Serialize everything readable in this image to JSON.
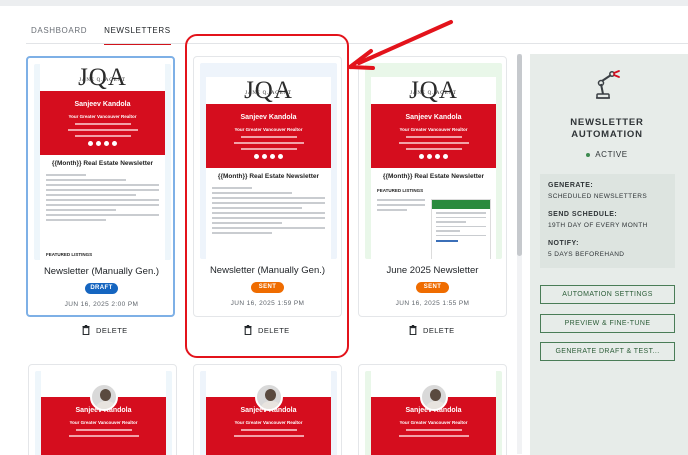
{
  "tabs": [
    {
      "label": "DASHBOARD"
    },
    {
      "label": "NEWSLETTERS"
    }
  ],
  "logo": {
    "mark": "JQA",
    "sub": "JANE Q. AGENT"
  },
  "template": {
    "agent_name": "Sanjeev Kandola",
    "tagline": "Your Greater Vancouver Realtor",
    "newsletter_title": "{{Month}} Real Estate Newsletter",
    "featured_label": "FEATURED LISTINGS"
  },
  "cards": [
    {
      "title": "Newsletter (Manually Gen.)",
      "status": "DRAFT",
      "date": "JUN 16, 2025 2:00 PM",
      "delete_label": "DELETE"
    },
    {
      "title": "Newsletter (Manually Gen.)",
      "status": "SENT",
      "date": "JUN 16, 2025 1:59 PM",
      "delete_label": "DELETE"
    },
    {
      "title": "June 2025 Newsletter",
      "status": "SENT",
      "date": "JUN 16, 2025 1:55 PM",
      "delete_label": "DELETE"
    }
  ],
  "automation": {
    "title_line1": "NEWSLETTER",
    "title_line2": "AUTOMATION",
    "status": "ACTIVE",
    "generate_label": "GENERATE:",
    "generate_value": "SCHEDULED NEWSLETTERS",
    "schedule_label": "SEND SCHEDULE:",
    "schedule_value": "19TH DAY OF EVERY MONTH",
    "notify_label": "NOTIFY:",
    "notify_value": "5 DAYS BEFOREHAND",
    "buttons": [
      "AUTOMATION SETTINGS",
      "PREVIEW & FINE-TUNE",
      "GENERATE DRAFT & TEST..."
    ]
  },
  "colors": {
    "brand_red": "#d50d1e",
    "tab_accent": "#d1131b",
    "draft_badge": "#1565c0",
    "sent_badge": "#ef6c00",
    "active_dot": "#3c8a4f",
    "annotation": "#e3131b"
  }
}
